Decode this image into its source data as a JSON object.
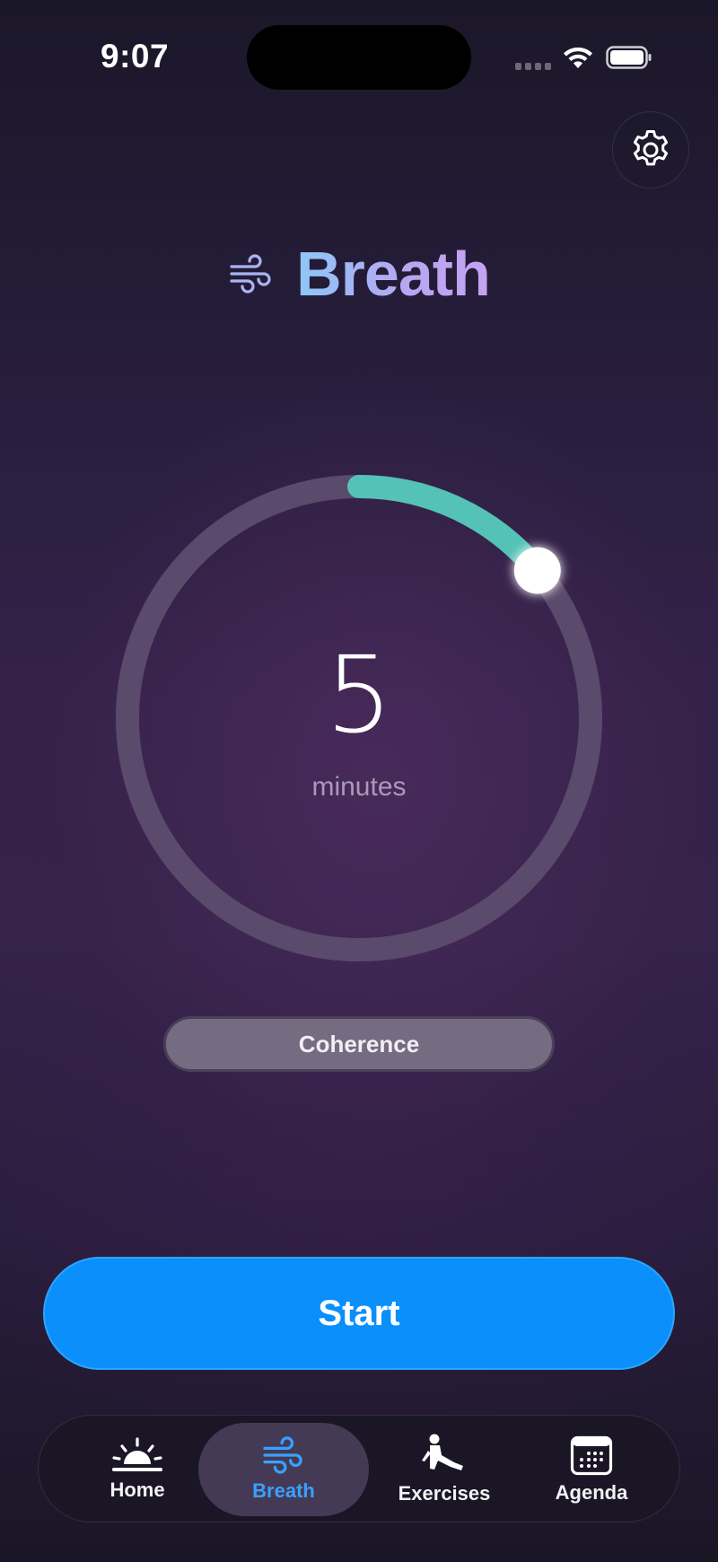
{
  "status_bar": {
    "time": "9:07"
  },
  "header": {
    "title": "Breath"
  },
  "dial": {
    "value": "5",
    "unit": "minutes",
    "progress_fraction": 0.14,
    "accent_color": "#54c2b6"
  },
  "mode": {
    "label": "Coherence"
  },
  "actions": {
    "start_label": "Start"
  },
  "tabs": [
    {
      "label": "Home",
      "icon": "sunrise-icon",
      "active": false
    },
    {
      "label": "Breath",
      "icon": "wind-icon",
      "active": true
    },
    {
      "label": "Exercises",
      "icon": "stretching-figure-icon",
      "active": false
    },
    {
      "label": "Agenda",
      "icon": "calendar-icon",
      "active": false
    }
  ],
  "colors": {
    "primary_button": "#0a8ffb",
    "active_tab_text": "#3aa0ff",
    "title_gradient_start": "#8ec7f7",
    "title_gradient_end": "#c6a2f2"
  }
}
